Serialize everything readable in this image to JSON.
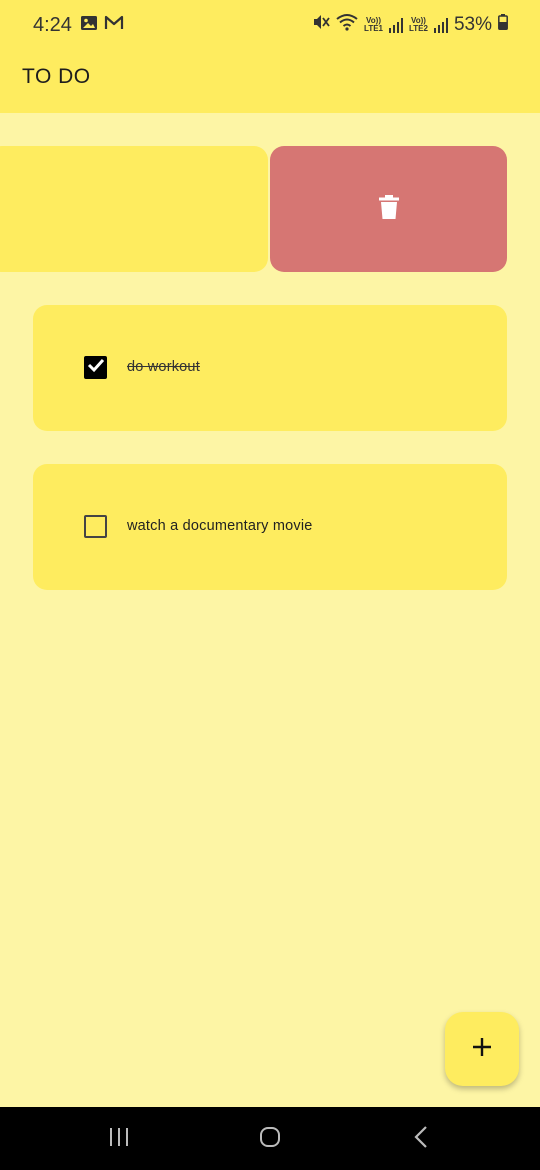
{
  "status_bar": {
    "time": "4:24",
    "left_icons": [
      "image-icon",
      "gmail-icon"
    ],
    "right_icons": [
      "mute-icon",
      "wifi-icon",
      "signal-icon",
      "signal-icon"
    ],
    "sim1_label": "LTE1",
    "sim2_label": "LTE2",
    "volte1": "Vo))",
    "volte2": "Vo))",
    "battery": "53%"
  },
  "app_bar": {
    "title": "TO DO"
  },
  "swipe": {
    "delete_icon": "trash-icon",
    "delete_color": "#d67673"
  },
  "todos": [
    {
      "text": "do workout",
      "done": true
    },
    {
      "text": "watch a documentary movie",
      "done": false
    }
  ],
  "fab": {
    "icon": "plus-icon"
  },
  "colors": {
    "background": "#fdf5a5",
    "accent": "#feec5f",
    "delete": "#d67673"
  },
  "nav_bar": {
    "buttons": [
      "recents-icon",
      "home-icon",
      "back-icon"
    ]
  }
}
